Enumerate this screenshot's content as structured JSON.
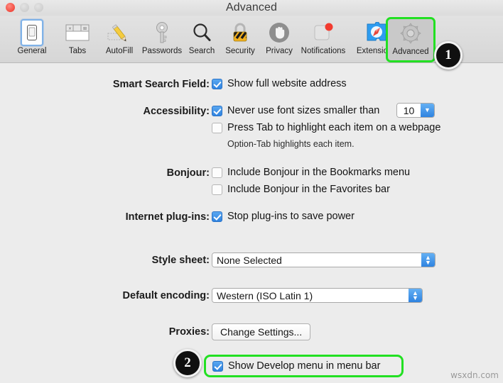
{
  "window": {
    "title": "Advanced",
    "traffic_lights": [
      "close",
      "minimize",
      "zoom"
    ]
  },
  "toolbar": {
    "tabs": [
      {
        "label": "General",
        "icon": "device-icon",
        "state": "selected"
      },
      {
        "label": "Tabs",
        "icon": "tabs-icon",
        "state": "normal"
      },
      {
        "label": "AutoFill",
        "icon": "pencil-form-icon",
        "state": "normal"
      },
      {
        "label": "Passwords",
        "icon": "key-icon",
        "state": "normal"
      },
      {
        "label": "Search",
        "icon": "magnifier-icon",
        "state": "normal"
      },
      {
        "label": "Security",
        "icon": "padlock-icon",
        "state": "normal"
      },
      {
        "label": "Privacy",
        "icon": "hand-stop-icon",
        "state": "normal"
      },
      {
        "label": "Notifications",
        "icon": "notification-badge-icon",
        "state": "normal"
      },
      {
        "label": "Extensions",
        "icon": "puzzle-compass-icon",
        "state": "normal"
      },
      {
        "label": "Advanced",
        "icon": "gear-icon",
        "state": "active-highlighted"
      }
    ]
  },
  "settings": {
    "smart_search_field": {
      "label": "Smart Search Field:",
      "option": {
        "text": "Show full website address",
        "checked": true
      }
    },
    "accessibility": {
      "label": "Accessibility:",
      "font_size_option": {
        "text": "Never use font sizes smaller than",
        "checked": true
      },
      "font_size_value": "10",
      "tab_highlight_option": {
        "text": "Press Tab to highlight each item on a webpage",
        "checked": false
      },
      "note": "Option-Tab highlights each item."
    },
    "bonjour": {
      "label": "Bonjour:",
      "options": [
        {
          "text": "Include Bonjour in the Bookmarks menu",
          "checked": false
        },
        {
          "text": "Include Bonjour in the Favorites bar",
          "checked": false
        }
      ]
    },
    "internet_plugins": {
      "label": "Internet plug-ins:",
      "option": {
        "text": "Stop plug-ins to save power",
        "checked": true
      }
    },
    "style_sheet": {
      "label": "Style sheet:",
      "value": "None Selected"
    },
    "default_encoding": {
      "label": "Default encoding:",
      "value": "Western (ISO Latin 1)"
    },
    "proxies": {
      "label": "Proxies:",
      "button": "Change Settings..."
    },
    "develop_menu": {
      "option": {
        "text": "Show Develop menu in menu bar",
        "checked": true
      }
    }
  },
  "callouts": [
    {
      "number": "1"
    },
    {
      "number": "2"
    }
  ],
  "colors": {
    "highlight_green": "#22e022",
    "checkbox_blue": "#2f83e0",
    "selection_blue": "#7fb2e8",
    "badge_black": "#101010"
  },
  "watermark": "wsxdn.com"
}
